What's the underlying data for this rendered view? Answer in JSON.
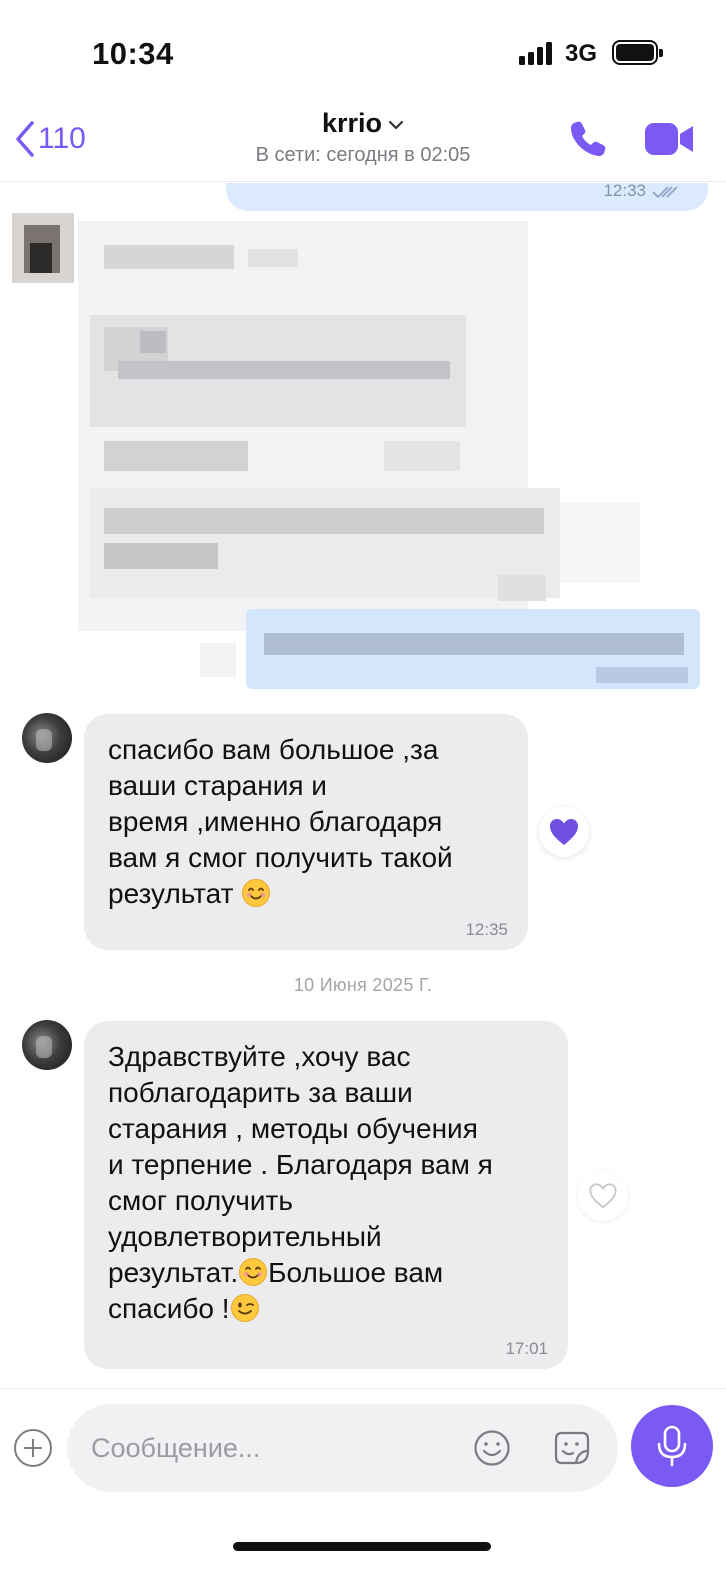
{
  "status_bar": {
    "time": "10:34",
    "network": "3G"
  },
  "header": {
    "back_count": "110",
    "contact_name": "krrio",
    "presence": "В сети: сегодня в 02:05"
  },
  "messages": {
    "top_outgoing_time": "12:33",
    "msg1": {
      "text": "спасибо вам большое ,за\nваши старания и\nвремя ,именно благодаря\nвам я смог получить такой\nрезультат ",
      "time": "12:35",
      "reaction": "filled-heart"
    },
    "date_separator": "10 Июня 2025 Г.",
    "msg2": {
      "text_part1": "Здравствуйте ,хочу вас\nпоблагодарить за ваши\nстарания ,  методы обучения\nи  терпение . Благодаря вам я\nсмог получить\nудовлетворительный\nрезультат.",
      "text_part2": "Большое вам\nспасибо !",
      "time": "17:01",
      "reaction": "outline-heart"
    }
  },
  "input": {
    "placeholder": "Сообщение..."
  },
  "colors": {
    "accent": "#7b5af4",
    "outgoing_bubble": "#dbeafc",
    "incoming_bubble": "#ececef"
  }
}
